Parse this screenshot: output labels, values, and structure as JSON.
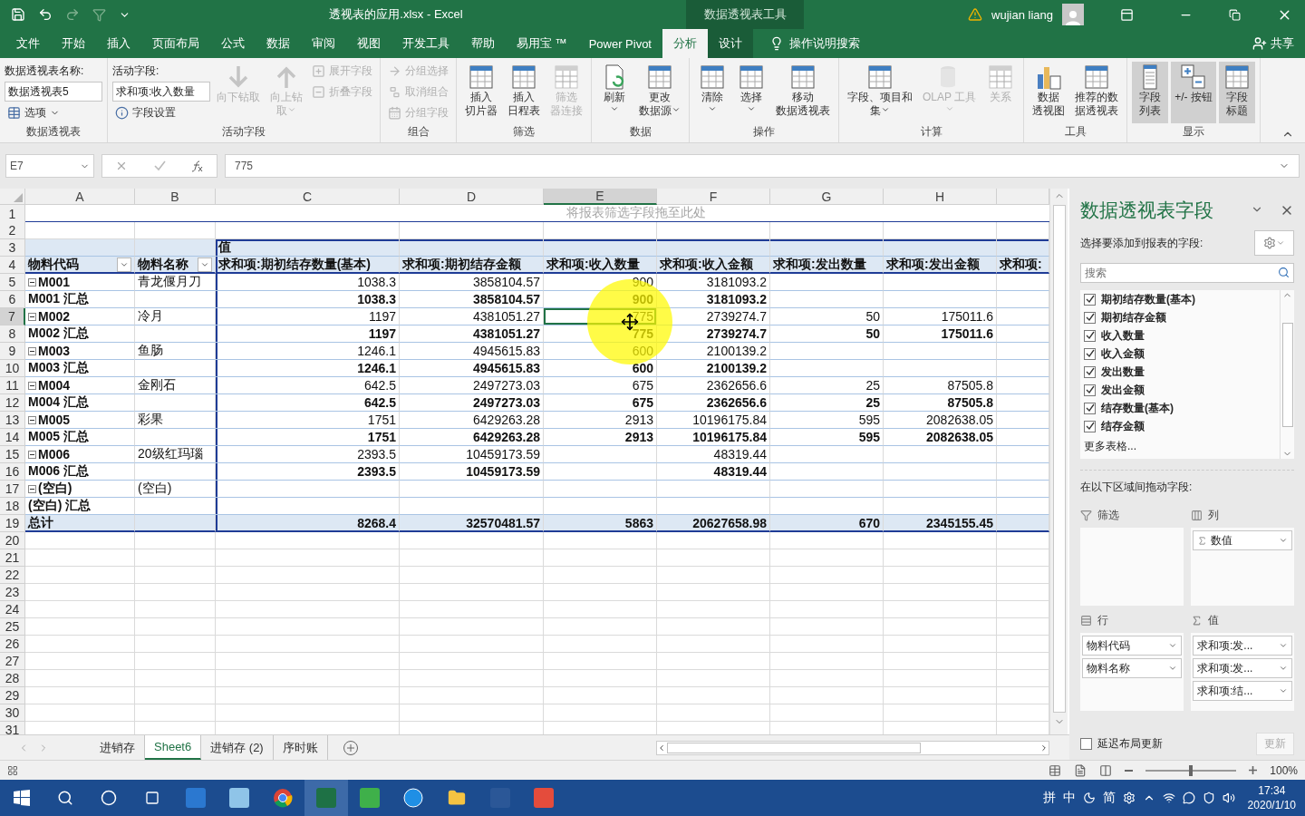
{
  "title_bar": {
    "file_title": "透视表的应用.xlsx - Excel",
    "context_title": "数据透视表工具",
    "user": "wujian liang"
  },
  "menu_tabs": [
    {
      "label": "文件",
      "selected": false,
      "contextual": false
    },
    {
      "label": "开始",
      "selected": false,
      "contextual": false
    },
    {
      "label": "插入",
      "selected": false,
      "contextual": false
    },
    {
      "label": "页面布局",
      "selected": false,
      "contextual": false
    },
    {
      "label": "公式",
      "selected": false,
      "contextual": false
    },
    {
      "label": "数据",
      "selected": false,
      "contextual": false
    },
    {
      "label": "审阅",
      "selected": false,
      "contextual": false
    },
    {
      "label": "视图",
      "selected": false,
      "contextual": false
    },
    {
      "label": "开发工具",
      "selected": false,
      "contextual": false
    },
    {
      "label": "帮助",
      "selected": false,
      "contextual": false
    },
    {
      "label": "易用宝 ™",
      "selected": false,
      "contextual": false
    },
    {
      "label": "Power Pivot",
      "selected": false,
      "contextual": false
    },
    {
      "label": "分析",
      "selected": true,
      "contextual": true
    },
    {
      "label": "设计",
      "selected": false,
      "contextual": true
    }
  ],
  "tell_me": "操作说明搜索",
  "share": "共享",
  "ribbon_groups": [
    {
      "label": "数据透视表",
      "columns": [
        [
          {
            "kind": "label",
            "text": "数据透视表名称:"
          },
          {
            "kind": "field",
            "value": "数据透视表5"
          },
          {
            "kind": "small",
            "lines": [
              "选项"
            ],
            "dropdown": true,
            "disabled": false
          }
        ]
      ]
    },
    {
      "label": "活动字段",
      "columns": [
        [
          {
            "kind": "label",
            "text": "活动字段:"
          },
          {
            "kind": "field",
            "value": "求和项:收入数量"
          },
          {
            "kind": "small",
            "lines": [
              "字段设置"
            ],
            "dropdown": false,
            "disabled": false
          }
        ],
        [
          {
            "kind": "big",
            "lines": [
              "向下钻取"
            ],
            "dropdown": false,
            "disabled": true
          }
        ],
        [
          {
            "kind": "big",
            "lines": [
              "向上钻",
              "取"
            ],
            "dropdown": true,
            "disabled": true
          }
        ],
        [
          {
            "kind": "small",
            "lines": [
              "展开字段"
            ],
            "dropdown": false,
            "disabled": true
          },
          {
            "kind": "small",
            "lines": [
              "折叠字段"
            ],
            "dropdown": false,
            "disabled": true
          }
        ]
      ]
    },
    {
      "label": "组合",
      "columns": [
        [
          {
            "kind": "small",
            "lines": [
              "分组选择"
            ],
            "dropdown": false,
            "disabled": true
          },
          {
            "kind": "small",
            "lines": [
              "取消组合"
            ],
            "dropdown": false,
            "disabled": true
          },
          {
            "kind": "small",
            "lines": [
              "分组字段"
            ],
            "dropdown": false,
            "disabled": true
          }
        ]
      ]
    },
    {
      "label": "筛选",
      "columns": [
        [
          {
            "kind": "big",
            "lines": [
              "插入",
              "切片器"
            ],
            "dropdown": false,
            "disabled": false
          }
        ],
        [
          {
            "kind": "big",
            "lines": [
              "插入",
              "日程表"
            ],
            "dropdown": false,
            "disabled": false
          }
        ],
        [
          {
            "kind": "big",
            "lines": [
              "筛选",
              "器连接"
            ],
            "dropdown": false,
            "disabled": true
          }
        ]
      ]
    },
    {
      "label": "数据",
      "columns": [
        [
          {
            "kind": "big",
            "lines": [
              "刷新"
            ],
            "dropdown": true,
            "disabled": false
          }
        ],
        [
          {
            "kind": "big",
            "lines": [
              "更改",
              "数据源"
            ],
            "dropdown": true,
            "disabled": false
          }
        ]
      ]
    },
    {
      "label": "操作",
      "columns": [
        [
          {
            "kind": "big",
            "lines": [
              "清除"
            ],
            "dropdown": true,
            "disabled": false
          }
        ],
        [
          {
            "kind": "big",
            "lines": [
              "选择"
            ],
            "dropdown": true,
            "disabled": false
          }
        ],
        [
          {
            "kind": "big",
            "lines": [
              "移动",
              "数据透视表"
            ],
            "dropdown": false,
            "disabled": false
          }
        ]
      ]
    },
    {
      "label": "计算",
      "columns": [
        [
          {
            "kind": "big",
            "lines": [
              "字段、项目和",
              "集"
            ],
            "dropdown": true,
            "disabled": false
          }
        ],
        [
          {
            "kind": "big",
            "lines": [
              "OLAP 工具"
            ],
            "dropdown": true,
            "disabled": true
          }
        ],
        [
          {
            "kind": "big",
            "lines": [
              "关系"
            ],
            "dropdown": false,
            "disabled": true
          }
        ]
      ]
    },
    {
      "label": "工具",
      "columns": [
        [
          {
            "kind": "big",
            "lines": [
              "数据",
              "透视图"
            ],
            "dropdown": false,
            "disabled": false
          }
        ],
        [
          {
            "kind": "big",
            "lines": [
              "推荐的数",
              "据透视表"
            ],
            "dropdown": false,
            "disabled": false
          }
        ]
      ]
    },
    {
      "label": "显示",
      "columns": [
        [
          {
            "kind": "big",
            "lines": [
              "字段",
              "列表"
            ],
            "dropdown": false,
            "disabled": false,
            "on": true
          }
        ],
        [
          {
            "kind": "big",
            "lines": [
              "+/- 按钮"
            ],
            "dropdown": false,
            "disabled": false,
            "on": true
          }
        ],
        [
          {
            "kind": "big",
            "lines": [
              "字段",
              "标题"
            ],
            "dropdown": false,
            "disabled": false,
            "on": true
          }
        ]
      ]
    }
  ],
  "formula_bar": {
    "name_box": "E7",
    "formula": "775"
  },
  "column_headers": [
    {
      "letter": "A",
      "selected": false
    },
    {
      "letter": "B",
      "selected": false
    },
    {
      "letter": "C",
      "selected": false
    },
    {
      "letter": "D",
      "selected": false
    },
    {
      "letter": "E",
      "selected": true
    },
    {
      "letter": "F",
      "selected": false
    },
    {
      "letter": "G",
      "selected": false
    },
    {
      "letter": "H",
      "selected": false
    }
  ],
  "rows": [
    {
      "number": "1",
      "kind": "hint",
      "selected": false,
      "text": "将报表筛选字段拖至此处"
    },
    {
      "number": "2",
      "kind": "blank",
      "selected": false
    },
    {
      "number": "3",
      "kind": "caption",
      "selected": false,
      "cells": [
        null,
        null,
        "值"
      ]
    },
    {
      "number": "4",
      "kind": "header",
      "selected": false,
      "cells": [
        "物料代码",
        "物料名称",
        "求和项:期初结存数量(基本)",
        "求和项:期初结存金额",
        "求和项:收入数量",
        "求和项:收入金额",
        "求和项:发出数量",
        "求和项:发出金额",
        "求和项:"
      ]
    },
    {
      "number": "5",
      "kind": "item",
      "selected": false,
      "cells": [
        "M001",
        "青龙偃月刀",
        "1038.3",
        "3858104.57",
        "900",
        "3181093.2"
      ]
    },
    {
      "number": "6",
      "kind": "subtotal",
      "selected": false,
      "cells": [
        "M001 汇总",
        null,
        "1038.3",
        "3858104.57",
        "900",
        "3181093.2"
      ]
    },
    {
      "number": "7",
      "kind": "item",
      "selected": true,
      "cells": [
        "M002",
        "冷月",
        "1197",
        "4381051.27",
        "775",
        "2739274.7",
        "50",
        "175011.6"
      ]
    },
    {
      "number": "8",
      "kind": "subtotal",
      "selected": false,
      "cells": [
        "M002 汇总",
        null,
        "1197",
        "4381051.27",
        "775",
        "2739274.7",
        "50",
        "175011.6"
      ]
    },
    {
      "number": "9",
      "kind": "item",
      "selected": false,
      "cells": [
        "M003",
        "鱼肠",
        "1246.1",
        "4945615.83",
        "600",
        "2100139.2"
      ]
    },
    {
      "number": "10",
      "kind": "subtotal",
      "selected": false,
      "cells": [
        "M003 汇总",
        null,
        "1246.1",
        "4945615.83",
        "600",
        "2100139.2"
      ]
    },
    {
      "number": "11",
      "kind": "item",
      "selected": false,
      "cells": [
        "M004",
        "金刚石",
        "642.5",
        "2497273.03",
        "675",
        "2362656.6",
        "25",
        "87505.8"
      ]
    },
    {
      "number": "12",
      "kind": "subtotal",
      "selected": false,
      "cells": [
        "M004 汇总",
        null,
        "642.5",
        "2497273.03",
        "675",
        "2362656.6",
        "25",
        "87505.8"
      ]
    },
    {
      "number": "13",
      "kind": "item",
      "selected": false,
      "cells": [
        "M005",
        "彩果",
        "1751",
        "6429263.28",
        "2913",
        "10196175.84",
        "595",
        "2082638.05"
      ]
    },
    {
      "number": "14",
      "kind": "subtotal",
      "selected": false,
      "cells": [
        "M005 汇总",
        null,
        "1751",
        "6429263.28",
        "2913",
        "10196175.84",
        "595",
        "2082638.05"
      ]
    },
    {
      "number": "15",
      "kind": "item",
      "selected": false,
      "cells": [
        "M006",
        "20级红玛瑙",
        "2393.5",
        "10459173.59",
        null,
        "48319.44"
      ]
    },
    {
      "number": "16",
      "kind": "subtotal",
      "selected": false,
      "cells": [
        "M006 汇总",
        null,
        "2393.5",
        "10459173.59",
        null,
        "48319.44"
      ]
    },
    {
      "number": "17",
      "kind": "item",
      "selected": false,
      "cells": [
        "(空白)",
        "(空白)"
      ]
    },
    {
      "number": "18",
      "kind": "subtotal",
      "selected": false,
      "cells": [
        "(空白) 汇总"
      ]
    },
    {
      "number": "19",
      "kind": "total",
      "selected": false,
      "cells": [
        "总计",
        null,
        "8268.4",
        "32570481.57",
        "5863",
        "20627658.98",
        "670",
        "2345155.45"
      ]
    },
    {
      "number": "20",
      "kind": "blank",
      "selected": false
    },
    {
      "number": "21",
      "kind": "blank",
      "selected": false
    },
    {
      "number": "22",
      "kind": "blank",
      "selected": false
    },
    {
      "number": "23",
      "kind": "blank",
      "selected": false
    },
    {
      "number": "24",
      "kind": "blank",
      "selected": false
    },
    {
      "number": "25",
      "kind": "blank",
      "selected": false
    },
    {
      "number": "26",
      "kind": "blank",
      "selected": false
    },
    {
      "number": "27",
      "kind": "blank",
      "selected": false
    },
    {
      "number": "28",
      "kind": "blank",
      "selected": false
    },
    {
      "number": "29",
      "kind": "blank",
      "selected": false
    },
    {
      "number": "30",
      "kind": "blank",
      "selected": false
    },
    {
      "number": "31",
      "kind": "blank",
      "selected": false
    }
  ],
  "sheet_tabs": [
    {
      "label": "进销存",
      "selected": false
    },
    {
      "label": "Sheet6",
      "selected": true
    },
    {
      "label": "进销存 (2)",
      "selected": false
    },
    {
      "label": "序时账",
      "selected": false
    }
  ],
  "field_pane": {
    "title": "数据透视表字段",
    "subtitle": "选择要添加到报表的字段:",
    "search_placeholder": "搜索",
    "fields": [
      {
        "label": "期初结存数量(基本)",
        "checked": true
      },
      {
        "label": "期初结存金额",
        "checked": true
      },
      {
        "label": "收入数量",
        "checked": true
      },
      {
        "label": "收入金额",
        "checked": true
      },
      {
        "label": "发出数量",
        "checked": true
      },
      {
        "label": "发出金额",
        "checked": true
      },
      {
        "label": "结存数量(基本)",
        "checked": true
      },
      {
        "label": "结存金额",
        "checked": true
      }
    ],
    "more_tables": "更多表格...",
    "areas_caption": "在以下区域间拖动字段:",
    "areas": [
      {
        "kind": "filters",
        "label": "筛选"
      },
      {
        "kind": "columns",
        "label": "列",
        "items": [
          "数值"
        ]
      },
      {
        "kind": "rows",
        "label": "行",
        "items": [
          "物料代码",
          "物料名称"
        ]
      },
      {
        "kind": "values",
        "label": "值",
        "items": [
          "求和项:发...",
          "求和项:发...",
          "求和项:结..."
        ]
      }
    ],
    "defer_label": "延迟布局更新",
    "defer_checked": false,
    "update_button": "更新",
    "update_disabled": true
  },
  "status_bar": {
    "zoom": "100%",
    "level": 0.5
  },
  "taskbar": {
    "ime": [
      "拼",
      "中"
    ],
    "ime_mode": "简",
    "time": "17:34",
    "date": "2020/1/10"
  }
}
